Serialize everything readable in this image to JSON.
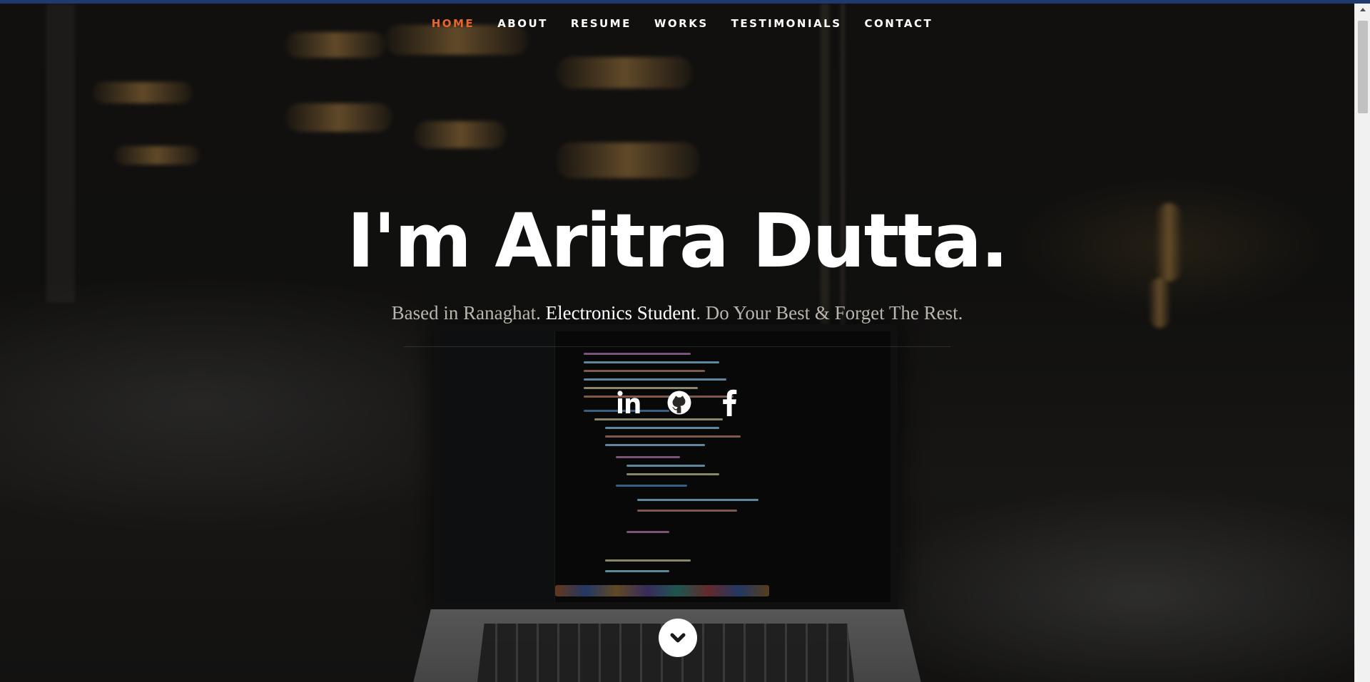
{
  "nav": {
    "items": [
      {
        "label": "HOME",
        "active": true
      },
      {
        "label": "ABOUT",
        "active": false
      },
      {
        "label": "RESUME",
        "active": false
      },
      {
        "label": "WORKS",
        "active": false
      },
      {
        "label": "TESTIMONIALS",
        "active": false
      },
      {
        "label": "CONTACT",
        "active": false
      }
    ]
  },
  "banner": {
    "headline": "I'm Aritra Dutta.",
    "tagline_before": "Based in Ranaghat. ",
    "tagline_highlight": "Electronics Student",
    "tagline_after": ". Do Your Best & Forget The Rest."
  },
  "social": [
    {
      "icon": "linkedin-icon"
    },
    {
      "icon": "github-icon"
    },
    {
      "icon": "facebook-icon"
    }
  ],
  "scroll_down": {
    "icon": "chevron-down-icon"
  },
  "colors": {
    "accent": "#e8662b",
    "top_bar": "#1e3a6e",
    "text": "#ffffff",
    "tagline": "#b9b4ae"
  }
}
